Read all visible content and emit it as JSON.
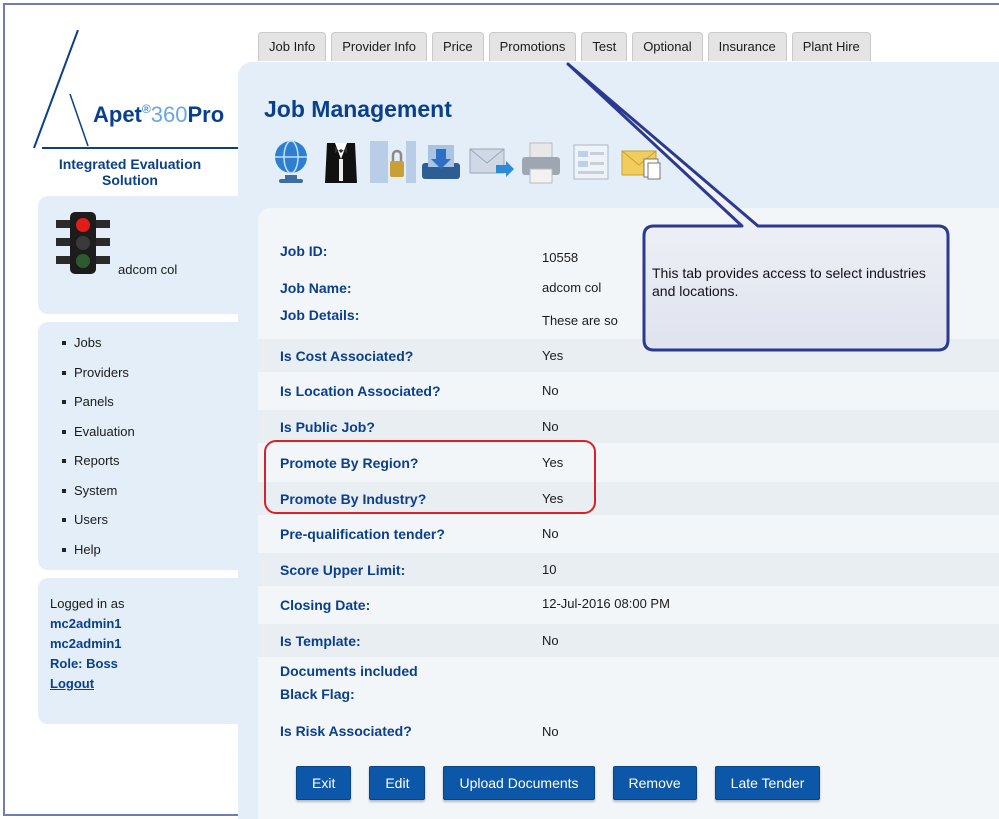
{
  "logo": {
    "brand": "Apet",
    "registered": "®",
    "number": "360",
    "suffix": "Pro",
    "tagline": "Integrated Evaluation Solution"
  },
  "user": {
    "name": "adcom col",
    "icon": "traffic-light-icon"
  },
  "sidebar": {
    "items": [
      {
        "label": "Jobs"
      },
      {
        "label": "Providers"
      },
      {
        "label": "Panels"
      },
      {
        "label": "Evaluation"
      },
      {
        "label": "Reports"
      },
      {
        "label": "System"
      },
      {
        "label": "Users"
      },
      {
        "label": "Help"
      }
    ]
  },
  "login": {
    "logged_in_as": "Logged in as",
    "user1": "mc2admin1",
    "user2": "mc2admin1",
    "role": "Role: Boss",
    "logout": "Logout"
  },
  "tabs": [
    {
      "label": "Job Info"
    },
    {
      "label": "Provider Info"
    },
    {
      "label": "Price"
    },
    {
      "label": "Promotions"
    },
    {
      "label": "Test"
    },
    {
      "label": "Optional"
    },
    {
      "label": "Insurance"
    },
    {
      "label": "Plant Hire"
    }
  ],
  "main": {
    "title": "Job Management",
    "toolbar_icons": [
      "globe-icon",
      "tuxedo-icon",
      "document-lock-icon",
      "download-tray-icon",
      "mail-forward-icon",
      "printer-icon",
      "form-icon",
      "mail-documents-icon"
    ]
  },
  "job": {
    "rows": [
      {
        "label": "Job ID:",
        "value": "10558"
      },
      {
        "label": "Job Name:",
        "value": "adcom col"
      },
      {
        "label": "Job Details:",
        "value": "These are so"
      },
      {
        "label": "Is Cost Associated?",
        "value": "Yes"
      },
      {
        "label": "Is Location Associated?",
        "value": "No"
      },
      {
        "label": "Is Public Job?",
        "value": "No"
      },
      {
        "label": "Promote By Region?",
        "value": "Yes"
      },
      {
        "label": "Promote By Industry?",
        "value": "Yes"
      },
      {
        "label": "Pre-qualification tender?",
        "value": "No"
      },
      {
        "label": "Score Upper Limit:",
        "value": "10"
      },
      {
        "label": "Closing Date:",
        "value": "12-Jul-2016 08:00 PM"
      },
      {
        "label": "Is Template:",
        "value": "No"
      },
      {
        "label": "Documents included",
        "value": ""
      },
      {
        "label": "Black Flag:",
        "value": ""
      },
      {
        "label": "Is Risk Associated?",
        "value": "No"
      }
    ]
  },
  "buttons": {
    "exit": "Exit",
    "edit": "Edit",
    "upload": "Upload Documents",
    "remove": "Remove",
    "late_tender": "Late Tender"
  },
  "callout": {
    "text": "This tab provides access to select industries and locations."
  },
  "colors": {
    "brand_blue": "#0a3f8c",
    "button_blue": "#0d57a8",
    "highlight_red": "#d8222a",
    "panel_bg": "#e3eef9"
  }
}
